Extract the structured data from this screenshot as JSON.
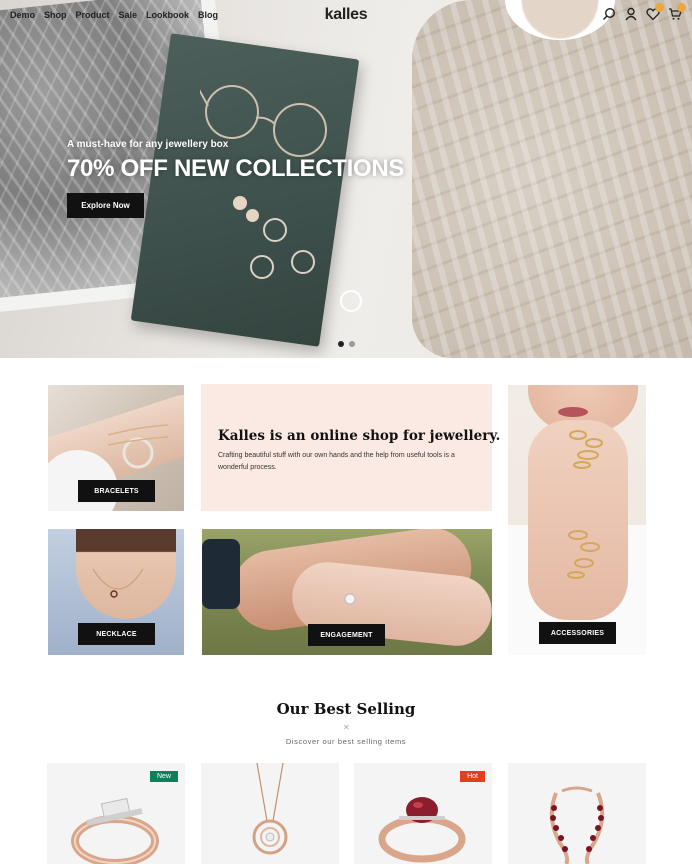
{
  "nav": {
    "items": [
      "Demo",
      "Shop",
      "Product",
      "Sale",
      "Lookbook",
      "Blog"
    ],
    "logo": "kalles",
    "icons": [
      "search-icon",
      "user-icon",
      "heart-icon",
      "cart-icon"
    ],
    "wishlist_count": "0",
    "cart_count": "0"
  },
  "hero": {
    "subtitle": "A must-have for any jewellery box",
    "title": "70% OFF NEW COLLECTIONS",
    "button": "Explore Now",
    "slide_count": 2,
    "active_slide": 1
  },
  "categories": {
    "bracelets": "BRACELETS",
    "necklace": "NECKLACE",
    "engagement": "ENGAGEMENT",
    "accessories": "ACCESSORIES"
  },
  "intro": {
    "title": "Kalles is an online shop for jewellery.",
    "text": "Crafting beautiful stuff with our own hands and the help from useful tools is a wonderful process."
  },
  "best_selling": {
    "title": "Our Best Selling",
    "subtitle": "Discover our best selling items",
    "products": [
      {
        "tag": "New"
      },
      {
        "tag": ""
      },
      {
        "tag": "Hot"
      },
      {
        "tag": ""
      }
    ]
  },
  "colors": {
    "accent_dark": "#111111",
    "intro_bg": "#fbeae3",
    "tag_new": "#0e7f5a",
    "tag_hot": "#e0401f",
    "badge": "#e8a83a"
  }
}
